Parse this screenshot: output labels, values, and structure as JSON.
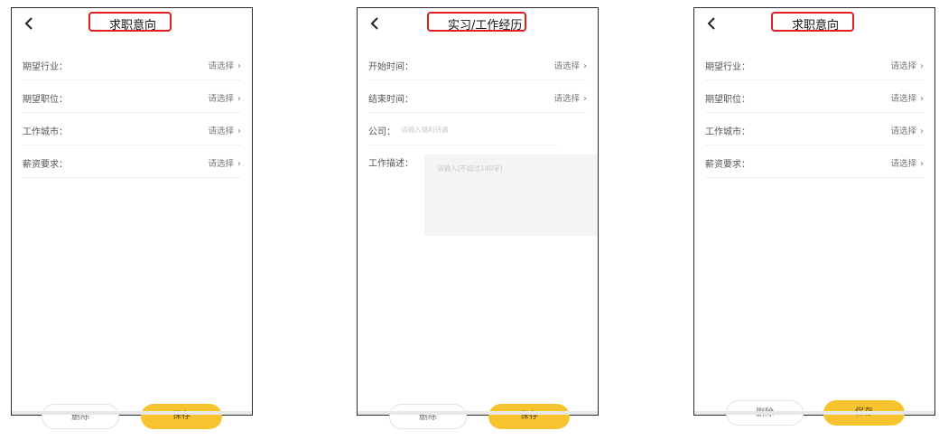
{
  "screens": [
    {
      "title": "求职意向",
      "rows": [
        {
          "label": "期望行业：",
          "value": "请选择"
        },
        {
          "label": "期望职位：",
          "value": "请选择"
        },
        {
          "label": "工作城市：",
          "value": "请选择"
        },
        {
          "label": "薪资要求：",
          "value": "请选择"
        }
      ],
      "delete_label": "删除",
      "save_label": "保存"
    },
    {
      "title": "实习/工作经历",
      "rows": [
        {
          "label": "开始时间：",
          "value": "请选择"
        },
        {
          "label": "结束时间：",
          "value": "请选择"
        }
      ],
      "company_label": "公司：",
      "company_placeholder": "请输入福利待遇",
      "desc_label": "工作描述：",
      "desc_placeholder": "请输入(不超过140字)",
      "delete_label": "删除",
      "save_label": "保存"
    },
    {
      "title": "求职意向",
      "rows": [
        {
          "label": "期望行业：",
          "value": "请选择"
        },
        {
          "label": "期望职位：",
          "value": "请选择"
        },
        {
          "label": "工作城市：",
          "value": "请选择"
        },
        {
          "label": "薪资要求：",
          "value": "请选择"
        }
      ],
      "delete_label": "删除",
      "save_label": "保存"
    }
  ],
  "icons": {
    "back": "chevron-left-icon",
    "row_arrow": "chevron-right-icon"
  },
  "colors": {
    "accent": "#f7c32e",
    "highlight_border": "#e02020"
  }
}
